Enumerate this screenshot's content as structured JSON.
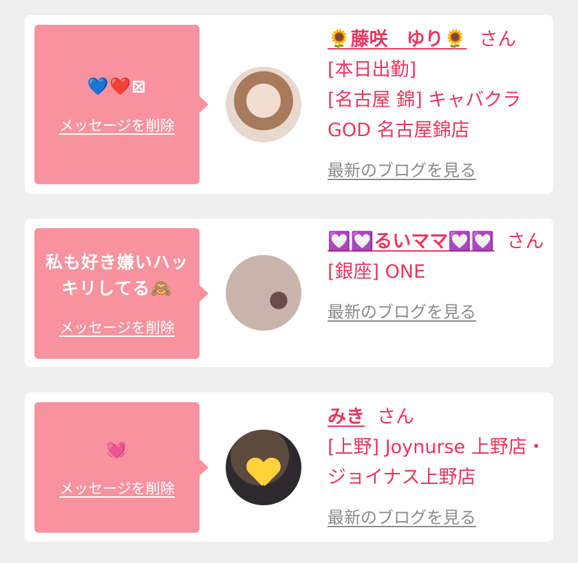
{
  "messages": [
    {
      "message": "💙❤️⊠",
      "delete_label": "メッセージを削除",
      "name": "🌻藤咲　ゆり🌻",
      "honorific": "さん",
      "lines": [
        "[本日出勤]",
        "[名古屋 錦] キャバクラGOD 名古屋錦店"
      ],
      "blog_label": "最新のブログを見る",
      "avatar_icon": "profile-photo"
    },
    {
      "message": "私も好き嫌いハッキリしてる🙈",
      "delete_label": "メッセージを削除",
      "name": "💟💟るいママ💟💟",
      "honorific": "さん",
      "lines": [
        "[銀座] ONE"
      ],
      "blog_label": "最新のブログを見る",
      "avatar_icon": "profile-photo"
    },
    {
      "message": "💓",
      "delete_label": "メッセージを削除",
      "name": "みき",
      "honorific": "さん",
      "lines": [
        "[上野] Joynurse 上野店・ジョイナス上野店"
      ],
      "blog_label": "最新のブログを見る",
      "avatar_icon": "yellow-heart-over-face"
    }
  ],
  "colors": {
    "bubble": "#f8929f",
    "accent": "#e8365e",
    "link_gray": "#8a8a8a",
    "background": "#efefef"
  }
}
